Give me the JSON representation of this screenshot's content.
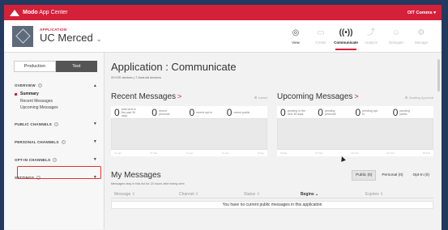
{
  "topbar": {
    "brand_bold": "Modo",
    "brand_rest": " App Center",
    "account": "OIT Comms ▾"
  },
  "app": {
    "kicker": "APPLICATION",
    "name": "UC Merced",
    "caret": "⌄"
  },
  "nav": [
    {
      "label": "View",
      "icon": "eye-icon",
      "glyph": "◎"
    },
    {
      "label": "Create",
      "icon": "window-icon",
      "glyph": "▭"
    },
    {
      "label": "Communicate",
      "icon": "broadcast-icon",
      "glyph": "((•))"
    },
    {
      "label": "Analyze",
      "icon": "chart-icon",
      "glyph": "⤴"
    },
    {
      "label": "Delegate",
      "icon": "users-icon",
      "glyph": "☺"
    },
    {
      "label": "Manage",
      "icon": "gear-icon",
      "glyph": "⚙"
    }
  ],
  "sidebar": {
    "toggle": {
      "production": "Production",
      "test": "Test"
    },
    "sections": {
      "overview": "OVERVIEW",
      "public_channels": "PUBLIC CHANNELS",
      "personal_channels": "PERSONAL CHANNELS",
      "opt_in_channels": "OPT-IN CHANNELS",
      "settings": "SETTINGS"
    },
    "overview_items": [
      "Summary",
      "Recent Messages",
      "Upcoming Messages"
    ]
  },
  "main": {
    "title": "Application : Communicate",
    "subtitle": "20 iOS devices | 7 Android devices",
    "recent": {
      "title": "Recent Messages",
      "link": "Instant",
      "stats": [
        {
          "num": "0",
          "label": "total sent in the past 30 days"
        },
        {
          "num": "0",
          "label": "recent personal"
        },
        {
          "num": "0",
          "label": "recent opt-in"
        },
        {
          "num": "0",
          "label": "recent public"
        }
      ],
      "axis": [
        "10 Jan",
        "07 Jan",
        "14 Jan",
        "21 Jan",
        "Today"
      ]
    },
    "upcoming": {
      "title": "Upcoming Messages",
      "link": "Awaiting Approval",
      "stats": [
        {
          "num": "0",
          "label": "pending in the next 30 days"
        },
        {
          "num": "0",
          "label": "pending personal"
        },
        {
          "num": "0",
          "label": "pending opt-in"
        },
        {
          "num": "0",
          "label": "pending public"
        }
      ],
      "axis": [
        "Today",
        "07 Feb",
        "14 Feb",
        "21 Feb",
        "28 Feb"
      ]
    },
    "my_messages": {
      "title": "My Messages",
      "note": "Messages stay in this list for 24 hours after being sent",
      "tabs": [
        "Public (0)",
        "Personal (0)",
        "Opt-In (0)"
      ],
      "columns": [
        "Message ⇳",
        "Channel ⇳",
        "Status ⇳",
        "Begins ⌄",
        "Expires ⇳"
      ],
      "empty": "You have no current public messages in this application"
    }
  },
  "colors": {
    "brand_red": "#d5203a",
    "highlight": "#e0352f",
    "outer": "#233a5e"
  }
}
